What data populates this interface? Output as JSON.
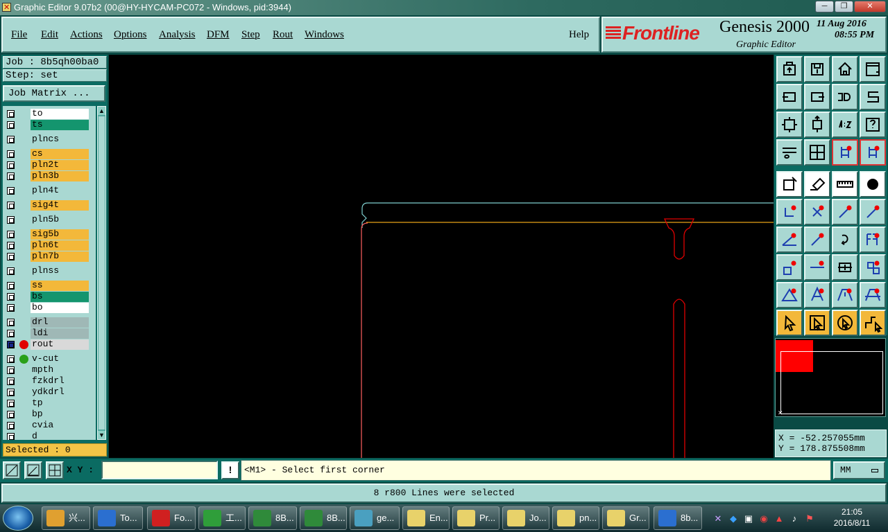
{
  "window": {
    "title": "Graphic Editor 9.07b2 (00@HY-HYCAM-PC072 - Windows, pid:3944)",
    "controls": [
      "─",
      "❐",
      "✕"
    ]
  },
  "menu": {
    "items": [
      "File",
      "Edit",
      "Actions",
      "Options",
      "Analysis",
      "DFM",
      "Step",
      "Rout",
      "Windows"
    ],
    "help": "Help"
  },
  "brand": {
    "logo": "Frontline",
    "product": "Genesis 2000",
    "subtitle": "Graphic Editor",
    "date": "11 Aug 2016",
    "time": "08:55 PM"
  },
  "job": {
    "job_label": "Job : 8b5qh00ba0",
    "step_label": "Step: set",
    "matrix_button": "Job Matrix ..."
  },
  "layers": [
    {
      "name": "to",
      "bg": "#ffffff",
      "dot": ""
    },
    {
      "name": "ts",
      "bg": "#14956e",
      "dot": ""
    },
    {
      "name": "plncs",
      "bg": "#a9d8d2",
      "dot": ""
    },
    {
      "name": "cs",
      "bg": "#f3b83a",
      "dot": ""
    },
    {
      "name": "pln2t",
      "bg": "#f3b83a",
      "dot": ""
    },
    {
      "name": "pln3b",
      "bg": "#f3b83a",
      "dot": ""
    },
    {
      "name": "pln4t",
      "bg": "#a9d8d2",
      "dot": ""
    },
    {
      "name": "sig4t",
      "bg": "#f3b83a",
      "dot": ""
    },
    {
      "name": "pln5b",
      "bg": "#a9d8d2",
      "dot": ""
    },
    {
      "name": "sig5b",
      "bg": "#f3b83a",
      "dot": ""
    },
    {
      "name": "pln6t",
      "bg": "#f3b83a",
      "dot": ""
    },
    {
      "name": "pln7b",
      "bg": "#f3b83a",
      "dot": ""
    },
    {
      "name": "plnss",
      "bg": "#a9d8d2",
      "dot": ""
    },
    {
      "name": "ss",
      "bg": "#f3b83a",
      "dot": ""
    },
    {
      "name": "bs",
      "bg": "#14956e",
      "dot": ""
    },
    {
      "name": "bo",
      "bg": "#ffffff",
      "dot": ""
    },
    {
      "name": "drl",
      "bg": "#9fb8b6",
      "dot": ""
    },
    {
      "name": "ldi",
      "bg": "#9fb8b6",
      "dot": ""
    },
    {
      "name": "rout",
      "bg": "#d9d9d9",
      "dot": "#e00000"
    },
    {
      "name": "v-cut",
      "bg": "#a9d8d2",
      "dot": "#2aa01a"
    },
    {
      "name": "mpth",
      "bg": "#a9d8d2",
      "dot": ""
    },
    {
      "name": "fzkdrl",
      "bg": "#a9d8d2",
      "dot": ""
    },
    {
      "name": "ydkdrl",
      "bg": "#a9d8d2",
      "dot": ""
    },
    {
      "name": "tp",
      "bg": "#a9d8d2",
      "dot": ""
    },
    {
      "name": "bp",
      "bg": "#a9d8d2",
      "dot": ""
    },
    {
      "name": "cvia",
      "bg": "#a9d8d2",
      "dot": ""
    },
    {
      "name": "d",
      "bg": "#a9d8d2",
      "dot": ""
    }
  ],
  "selected": "Selected : 0",
  "coords": {
    "x": "X = -52.257055mm",
    "y": "Y = 178.875508mm"
  },
  "bottom": {
    "xy_label": "X Y :",
    "xy_value": "",
    "warn": "!",
    "prompt": "<M1> - Select first corner",
    "unit": "MM",
    "status": "8 r800 Lines were selected"
  },
  "taskbar": {
    "tasks": [
      {
        "label": "兴...",
        "color": "#e0a030"
      },
      {
        "label": "To...",
        "color": "#2b6fd0"
      },
      {
        "label": "Fo...",
        "color": "#d02020"
      },
      {
        "label": "工...",
        "color": "#2f9e3a"
      },
      {
        "label": "8B...",
        "color": "#2f8a3a"
      },
      {
        "label": "8B...",
        "color": "#2f8a3a"
      },
      {
        "label": "ge...",
        "color": "#4aa0c0"
      },
      {
        "label": "En...",
        "color": "#e8d26a"
      },
      {
        "label": "Pr...",
        "color": "#e8d26a"
      },
      {
        "label": "Jo...",
        "color": "#e8d26a"
      },
      {
        "label": "pn...",
        "color": "#e8d26a"
      },
      {
        "label": "Gr...",
        "color": "#e8d26a"
      },
      {
        "label": "8b...",
        "color": "#2b6fd0"
      }
    ],
    "clock_time": "21:05",
    "clock_date": "2016/8/11"
  },
  "toolbar_icons": [
    "open-icon",
    "save-icon",
    "home-icon",
    "window-icon",
    "prev-icon",
    "next-icon",
    "undo-icon",
    "redo-icon",
    "zoom-fit-icon",
    "zoom-in-icon",
    "scale-icon",
    "help-icon",
    "snap-icon",
    "grid-icon",
    "net-icon",
    "net-red-icon",
    "fill-icon",
    "surface-icon",
    "ruler-icon",
    "pad-icon",
    "connect-icon",
    "cross-icon",
    "pin-icon",
    "pin2-icon",
    "line-icon",
    "arc-icon",
    "rotate-icon",
    "mirror-icon",
    "pad-add-icon",
    "line-add-icon",
    "move-icon",
    "array-icon",
    "triangle-icon",
    "polygon-icon",
    "polygon2-icon",
    "polygon3-icon",
    "select-icon",
    "select-box-icon",
    "select-circle-icon",
    "route-icon"
  ]
}
